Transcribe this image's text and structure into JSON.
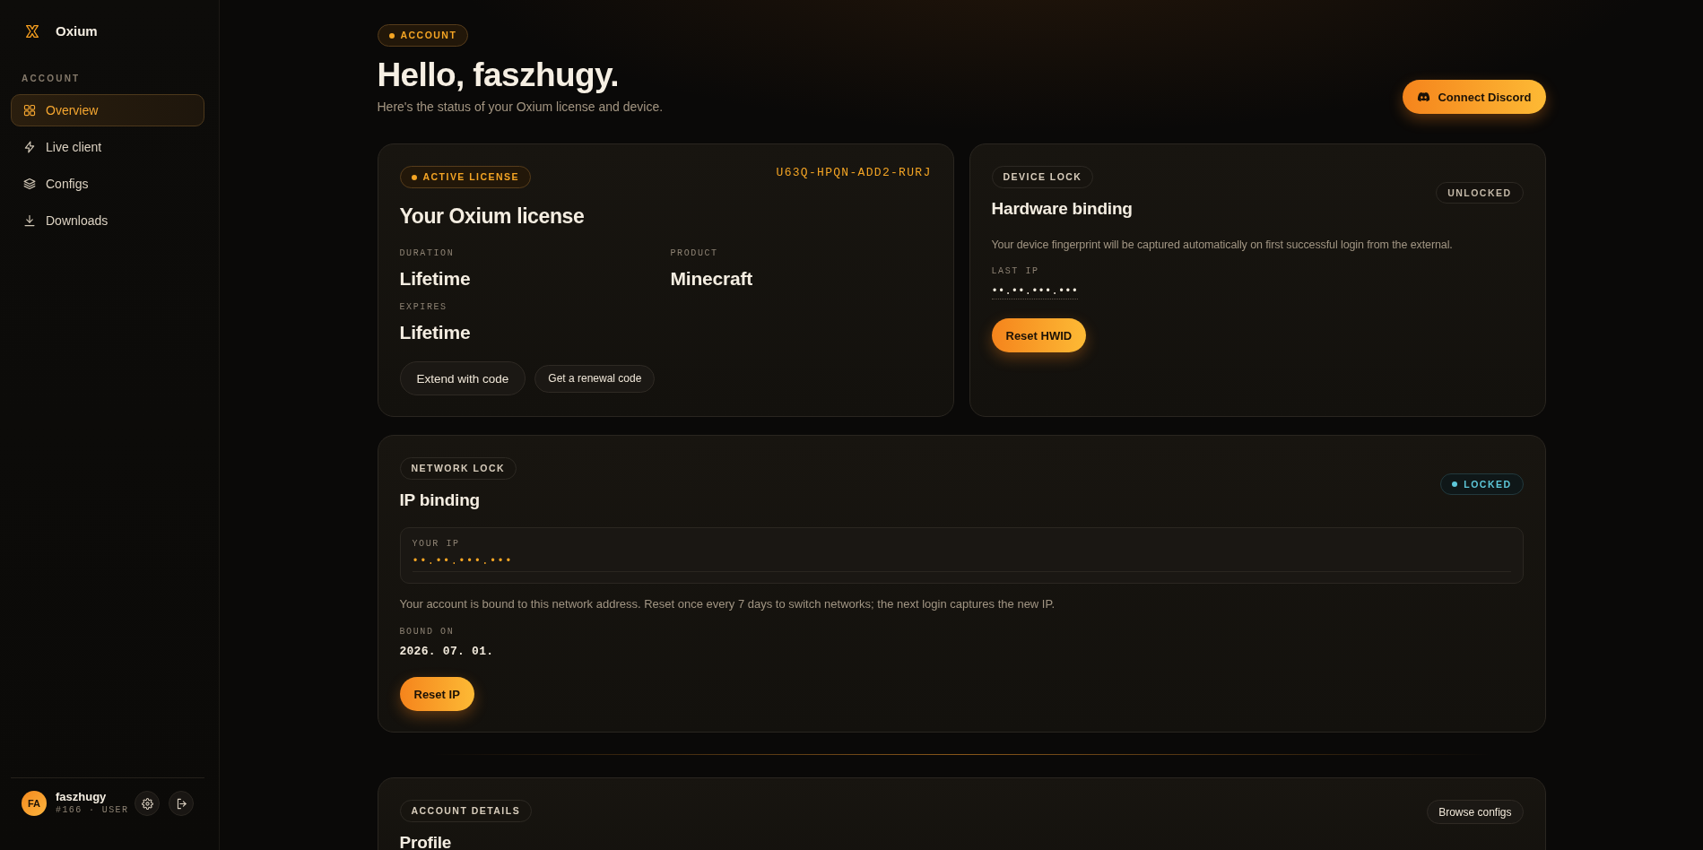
{
  "sidebar": {
    "brand": "Oxium",
    "section_label": "ACCOUNT",
    "items": [
      {
        "label": "Overview",
        "selected": true
      },
      {
        "label": "Live client",
        "selected": false
      },
      {
        "label": "Configs",
        "selected": false
      },
      {
        "label": "Downloads",
        "selected": false
      }
    ]
  },
  "user": {
    "initials": "FA",
    "name": "faszhugy",
    "meta": "#166 · USER"
  },
  "header": {
    "badge": {
      "text": "ACCOUNT",
      "highlighted": true
    },
    "title": "Hello, faszhugy.",
    "subtitle": "Here's the status of your Oxium license and device.",
    "action": "Connect Discord"
  },
  "license_card": {
    "badge": {
      "text": "ACTIVE LICENSE",
      "highlighted": true
    },
    "key": "U63Q-HPQN-ADD2-RURJ",
    "title": "Your Oxium license",
    "fields": [
      {
        "label": "DURATION",
        "value": "Lifetime"
      },
      {
        "label": "PRODUCT",
        "value": "Minecraft"
      },
      {
        "label": "EXPIRES",
        "value": "Lifetime"
      }
    ],
    "buttons": [
      {
        "label": "Extend with code",
        "kind": "regular"
      },
      {
        "label": "Get a renewal code",
        "kind": "compact"
      }
    ]
  },
  "device_card": {
    "badge": {
      "text": "DEVICE LOCK",
      "highlighted": false
    },
    "status": {
      "label": "UNLOCKED",
      "locked": false
    },
    "title": "Hardware binding",
    "description": "Your device fingerprint will be captured automatically on first successful login from the external.",
    "field": {
      "label": "LAST IP",
      "value": "••.••.•••.•••"
    },
    "button": "Reset HWID"
  },
  "network_card": {
    "badge": {
      "text": "NETWORK LOCK",
      "highlighted": false
    },
    "status": {
      "label": "LOCKED",
      "locked": true
    },
    "title": "IP binding",
    "ip_box": {
      "label": "YOUR IP",
      "value": "••.••.•••.•••"
    },
    "description": "Your account is bound to this network address. Reset once every 7 days to switch networks; the next login captures the new IP.",
    "field": {
      "label": "BOUND ON",
      "value": "2026. 07. 01."
    },
    "button": "Reset IP"
  },
  "details_card": {
    "badge": {
      "text": "ACCOUNT DETAILS",
      "highlighted": false
    },
    "title": "Profile",
    "button": "Browse configs"
  }
}
